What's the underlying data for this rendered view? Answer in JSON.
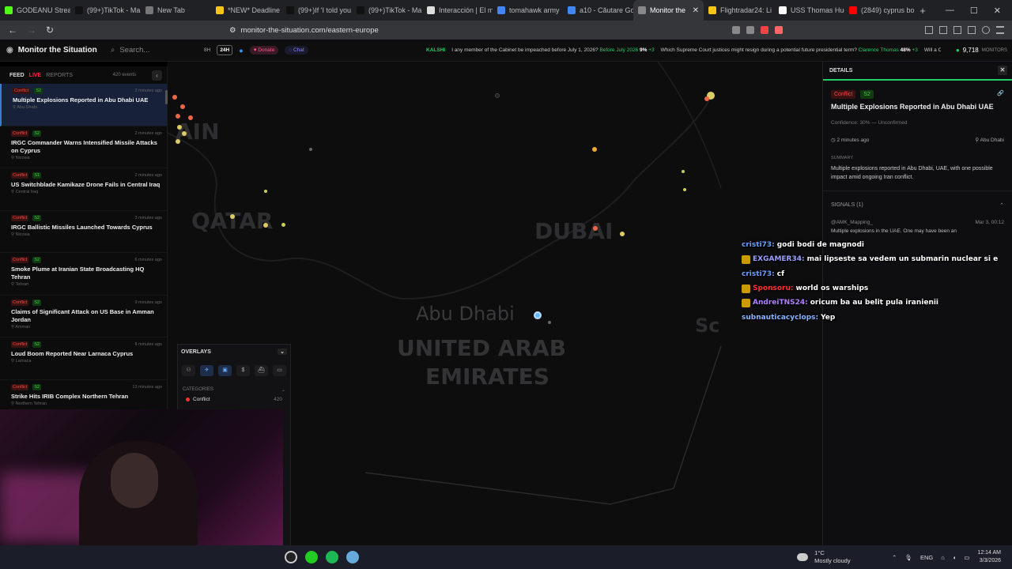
{
  "browser": {
    "tabs": [
      {
        "label": "GODEANU Strea",
        "color": "#53fc18"
      },
      {
        "label": "(99+)TikTok - Ma",
        "color": "#111111"
      },
      {
        "label": "New Tab",
        "color": "#777777"
      },
      {
        "label": "*NEW* Deadline",
        "color": "#f5c518"
      },
      {
        "label": "(99+)If 'I told you",
        "color": "#111111"
      },
      {
        "label": "(99+)TikTok - Ma",
        "color": "#111111"
      },
      {
        "label": "Interacción | El m",
        "color": "#dddddd"
      },
      {
        "label": "tomahawk army",
        "color": "#4285f4"
      },
      {
        "label": "a10 - Căutare Go",
        "color": "#4285f4"
      },
      {
        "label": "Monitor the",
        "color": "#888888"
      },
      {
        "label": "Flightradar24: Li",
        "color": "#f5c518"
      },
      {
        "label": "USS Thomas Hud",
        "color": "#ffffff"
      },
      {
        "label": "(2849) cyprus bo",
        "color": "#ff0000"
      }
    ],
    "active_tab": 9,
    "url": "monitor-the-situation.com/eastern-europe"
  },
  "app": {
    "title": "Monitor the Situation",
    "search_placeholder": "Search...",
    "range_8h": "8H",
    "range_24h": "24H",
    "donate": "Donate",
    "chat": "Chat",
    "monitors_count": "9,718",
    "monitors_label": "MONITORS"
  },
  "ticker": {
    "source": "KALSHI",
    "items": [
      {
        "q": "I any member of the Cabinet be impeached before July 1, 2026?",
        "date": "Before July 2026",
        "pct": "9%",
        "delta": "+3"
      },
      {
        "q": "Which Supreme Court justices might resign during a potential future presidential term?",
        "date": "Clarence Thomas",
        "pct": "48%",
        "delta": "+3"
      },
      {
        "q": "Will a Canadian team win the S",
        "date": "",
        "pct": "",
        "delta": ""
      }
    ]
  },
  "feed": {
    "tab_feed": "FEED",
    "tab_live": "LIVE",
    "tab_reports": "REPORTS",
    "count": "420 events",
    "items": [
      {
        "cat": "Conflict",
        "sev": "S2",
        "ago": "2 minutes ago",
        "title": "Multiple Explosions Reported in Abu Dhabi UAE",
        "loc": "Abu Dhabi"
      },
      {
        "cat": "Conflict",
        "sev": "S2",
        "ago": "2 minutes ago",
        "title": "IRGC Commander Warns Intensified Missile Attacks on Cyprus",
        "loc": "Nicosia"
      },
      {
        "cat": "Conflict",
        "sev": "S1",
        "ago": "2 minutes ago",
        "title": "US Switchblade Kamikaze Drone Fails in Central Iraq",
        "loc": "Central Iraq"
      },
      {
        "cat": "Conflict",
        "sev": "S2",
        "ago": "3 minutes ago",
        "title": "IRGC Ballistic Missiles Launched Towards Cyprus",
        "loc": "Nicosia"
      },
      {
        "cat": "Conflict",
        "sev": "S2",
        "ago": "6 minutes ago",
        "title": "Smoke Plume at Iranian State Broadcasting HQ Tehran",
        "loc": "Tehran"
      },
      {
        "cat": "Conflict",
        "sev": "S2",
        "ago": "9 minutes ago",
        "title": "Claims of Significant Attack on US Base in Amman Jordan",
        "loc": "Amman"
      },
      {
        "cat": "Conflict",
        "sev": "S2",
        "ago": "8 minutes ago",
        "title": "Loud Boom Reported Near Larnaca Cyprus",
        "loc": "Larnaca"
      },
      {
        "cat": "Conflict",
        "sev": "S2",
        "ago": "13 minutes ago",
        "title": "Strike Hits IRIB Complex Northern Tehran",
        "loc": "Northern Tehran"
      }
    ]
  },
  "map": {
    "labels": {
      "bahrain": "AIN",
      "qatar": "QATAR",
      "dubai": "DUBAI",
      "abu_dhabi": "Abu Dhabi",
      "uae_line1": "UNITED ARAB",
      "uae_line2": "EMIRATES",
      "edge": "Sc"
    }
  },
  "overlays": {
    "title": "OVERLAYS",
    "categories_label": "CATEGORIES",
    "categories": [
      {
        "name": "Conflict",
        "count": "420"
      }
    ]
  },
  "details": {
    "header": "DETAILS",
    "category": "Conflict",
    "severity": "S2",
    "title": "Multiple Explosions Reported in Abu Dhabi UAE",
    "confidence": "Confidence:  30% — Unconfirmed",
    "time": "2 minutes ago",
    "location": "Abu Dhabi",
    "summary_label": "SUMMARY",
    "summary": "Multiple explosions reported in Abu Dhabi, UAE, with one possible impact amid ongoing Iran conflict.",
    "signals_label": "SIGNALS (1)",
    "signal_author": "@AMK_Mapping_",
    "signal_time": "Mar 3, 00:12",
    "signal_text": "Multiple explosions in the UAE. One may have been an"
  },
  "chat": [
    {
      "user": "cristi73:",
      "color": "#6aa0ff",
      "msg": "godi bodi de magnodi",
      "icon": false
    },
    {
      "user": "EXGAMER34:",
      "color": "#9aa0ff",
      "msg": "mai lipseste sa vedem un submarin nuclear si e",
      "icon": true
    },
    {
      "user": "cristi73:",
      "color": "#6aa0ff",
      "msg": "cf",
      "icon": false
    },
    {
      "user": "Sponsoru:",
      "color": "#ff3030",
      "msg": "world os warships",
      "icon": true
    },
    {
      "user": "AndreiTNS24:",
      "color": "#b080ff",
      "msg": "oricum ba au belit pula iranienii",
      "icon": true
    },
    {
      "user": "subnauticacyclops:",
      "color": "#8ab4ff",
      "msg": "Yep",
      "icon": false
    }
  ],
  "taskbar": {
    "temp": "1°C",
    "weather": "Mostly cloudy",
    "lang": "ENG",
    "time": "12:14 AM",
    "date": "3/3/2026"
  },
  "colors": {
    "accent_green": "#22cc66",
    "conflict_red": "#ff4444",
    "selected_blue": "#3a7bd5"
  }
}
